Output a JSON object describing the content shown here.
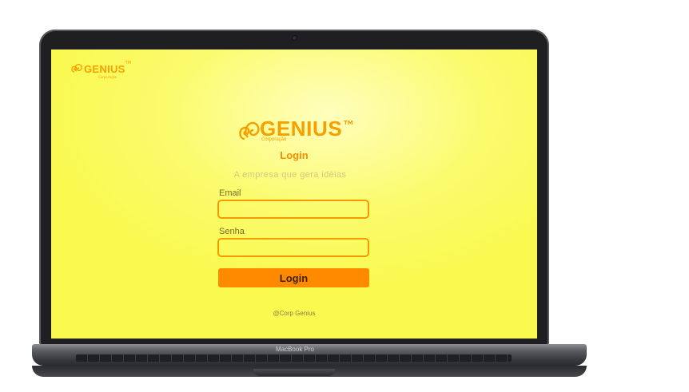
{
  "brand": {
    "name": "GENIUS",
    "trademark": "TM",
    "subtitle": "Corporação",
    "color": "#f5a000"
  },
  "login": {
    "title": "Login",
    "tagline": "A empresa que gera idéias",
    "email_label": "Email",
    "email_value": "",
    "password_label": "Senha",
    "password_value": "",
    "submit_label": "Login"
  },
  "footer": {
    "text": "@Corp Genius"
  },
  "device": {
    "model": "MacBook Pro"
  },
  "colors": {
    "background": "#fbfb6e",
    "accent": "#ff8a00",
    "input_border": "#f59a00"
  }
}
